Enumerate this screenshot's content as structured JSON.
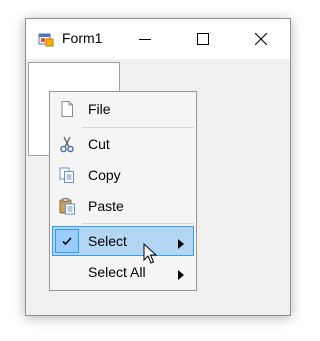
{
  "window": {
    "title": "Form1",
    "buttons": [
      "minimize",
      "maximize",
      "close"
    ]
  },
  "context_menu": {
    "items": [
      {
        "label": "File",
        "icon": "blank-page-icon",
        "has_submenu": false
      },
      {
        "label": "Cut",
        "icon": "scissors-icon",
        "has_submenu": false
      },
      {
        "label": "Copy",
        "icon": "copy-icon",
        "has_submenu": false
      },
      {
        "label": "Paste",
        "icon": "paste-icon",
        "has_submenu": false
      },
      {
        "label": "Select",
        "icon": "checkmark-icon",
        "has_submenu": true,
        "checked": true,
        "highlighted": true
      },
      {
        "label": "Select All",
        "icon": "",
        "has_submenu": true
      }
    ]
  },
  "colors": {
    "highlight_fill": "#b3d7f3",
    "highlight_border": "#3399ff"
  }
}
